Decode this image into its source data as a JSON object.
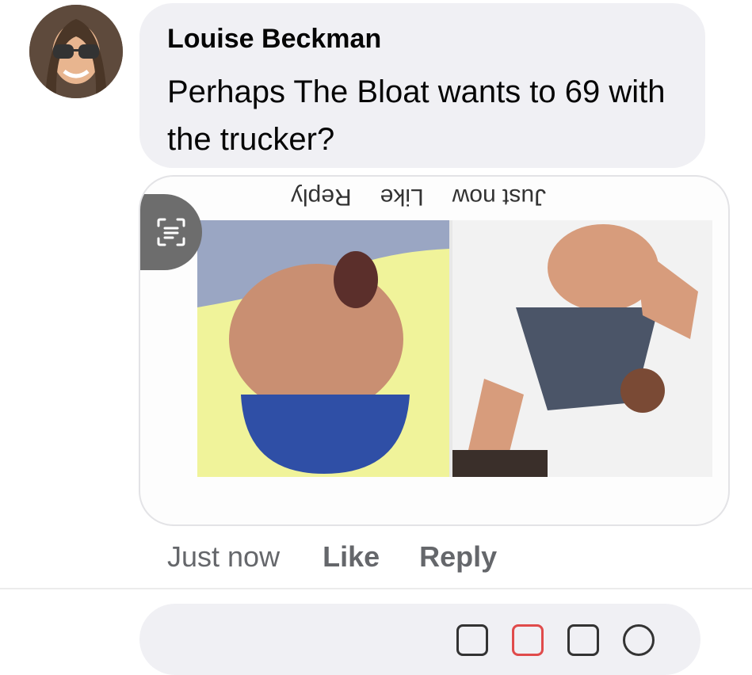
{
  "comment": {
    "author": "Louise Beckman",
    "text": "Perhaps  The Bloat wants to 69 with the trucker?",
    "actions": {
      "time": "Just now",
      "like": "Like",
      "reply": "Reply"
    }
  },
  "attachment": {
    "flipped_meta": {
      "time": "Just now",
      "like": "Like",
      "reply": "Reply"
    }
  },
  "icons": {
    "avatar": "avatar-photo",
    "lens": "text-scan-icon"
  }
}
